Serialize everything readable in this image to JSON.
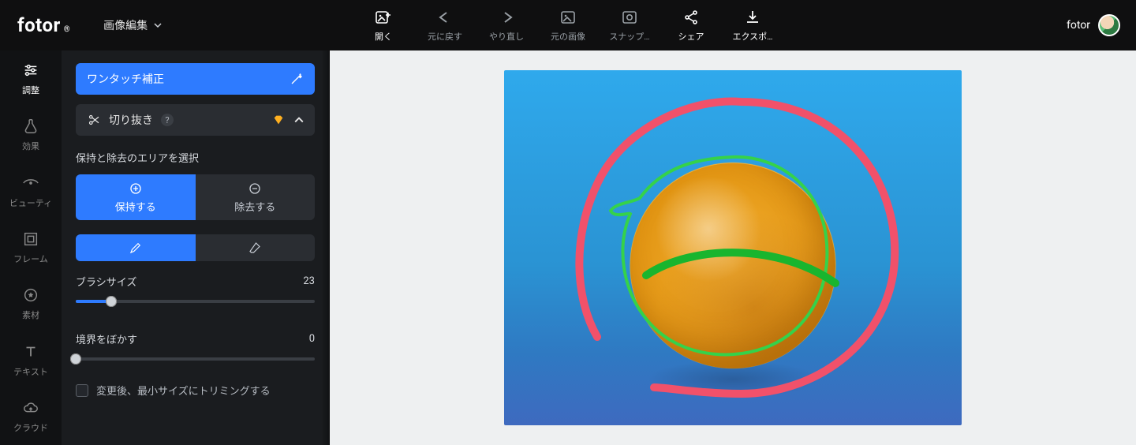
{
  "brand": {
    "name": "fotor",
    "mark": "®"
  },
  "mode": {
    "label": "画像編集"
  },
  "toolbar": {
    "open": {
      "label": "開く"
    },
    "undo": {
      "label": "元に戻す"
    },
    "redo": {
      "label": "やり直し"
    },
    "orig": {
      "label": "元の画像"
    },
    "snap": {
      "label": "スナップ…"
    },
    "share": {
      "label": "シェア"
    },
    "export": {
      "label": "エクスポ…"
    }
  },
  "user": {
    "name": "fotor"
  },
  "rail": {
    "adjust": {
      "label": "調整"
    },
    "effect": {
      "label": "効果"
    },
    "beauty": {
      "label": "ビューティ"
    },
    "frame": {
      "label": "フレーム"
    },
    "sticker": {
      "label": "素材"
    },
    "text": {
      "label": "テキスト"
    },
    "cloud": {
      "label": "クラウド"
    }
  },
  "panel": {
    "onetouch": {
      "label": "ワンタッチ補正"
    },
    "cutout": {
      "label": "切り抜き",
      "help": "?"
    },
    "section": {
      "title": "保持と除去のエリアを選択"
    },
    "keep": {
      "label": "保持する"
    },
    "remove": {
      "label": "除去する"
    },
    "brushsize": {
      "label": "ブラシサイズ",
      "value": "23",
      "percent": 15
    },
    "blur": {
      "label": "境界をぼかす",
      "value": "0",
      "percent": 0
    },
    "trim_check": {
      "label": "変更後、最小サイズにトリミングする"
    }
  },
  "colors": {
    "accent": "#2e7bff"
  }
}
